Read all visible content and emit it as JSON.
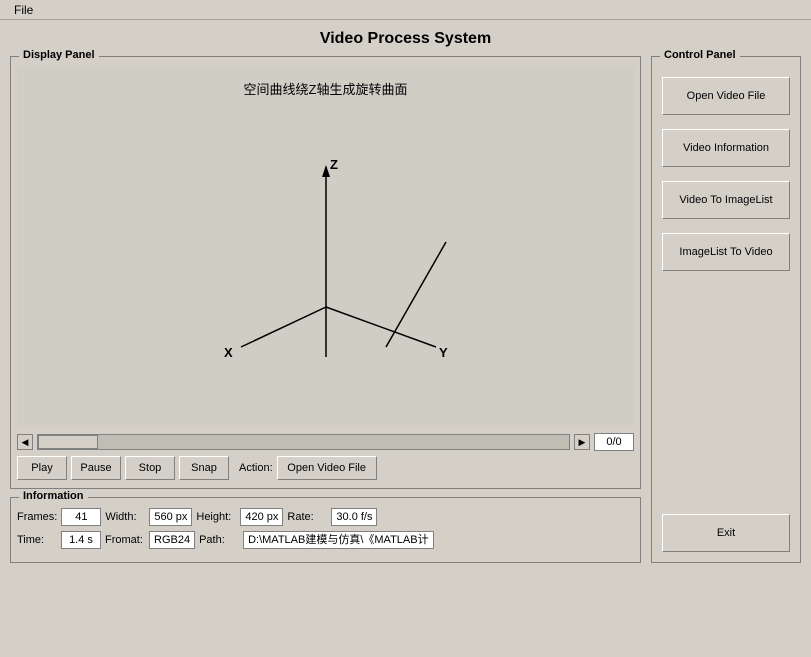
{
  "app": {
    "title": "Video Process System"
  },
  "menubar": {
    "items": [
      "File"
    ]
  },
  "display_panel": {
    "label": "Display Panel",
    "chart_title": "空间曲线绕Z轴生成旋转曲面",
    "axes_labels": {
      "z": "Z",
      "x": "X",
      "y": "Y"
    }
  },
  "scrollbar": {
    "counter": "0/0"
  },
  "controls": {
    "play": "Play",
    "pause": "Pause",
    "stop": "Stop",
    "snap": "Snap",
    "action_label": "Action:",
    "action_btn": "Open Video File"
  },
  "info_panel": {
    "label": "Information",
    "frames_label": "Frames:",
    "frames_value": "41",
    "width_label": "Width:",
    "width_value": "560 px",
    "height_label": "Height:",
    "height_value": "420 px",
    "rate_label": "Rate:",
    "rate_value": "30.0 f/s",
    "time_label": "Time:",
    "time_value": "1.4 s",
    "format_label": "Fromat:",
    "format_value": "RGB24",
    "path_label": "Path:",
    "path_value": "D:\\MATLAB建模与仿真\\《MATLAB计"
  },
  "control_panel": {
    "label": "Control Panel",
    "btn_open": "Open Video File",
    "btn_info": "Video Information",
    "btn_to_imagelist": "Video To ImageList",
    "btn_from_imagelist": "ImageList To Video",
    "btn_exit": "Exit"
  }
}
